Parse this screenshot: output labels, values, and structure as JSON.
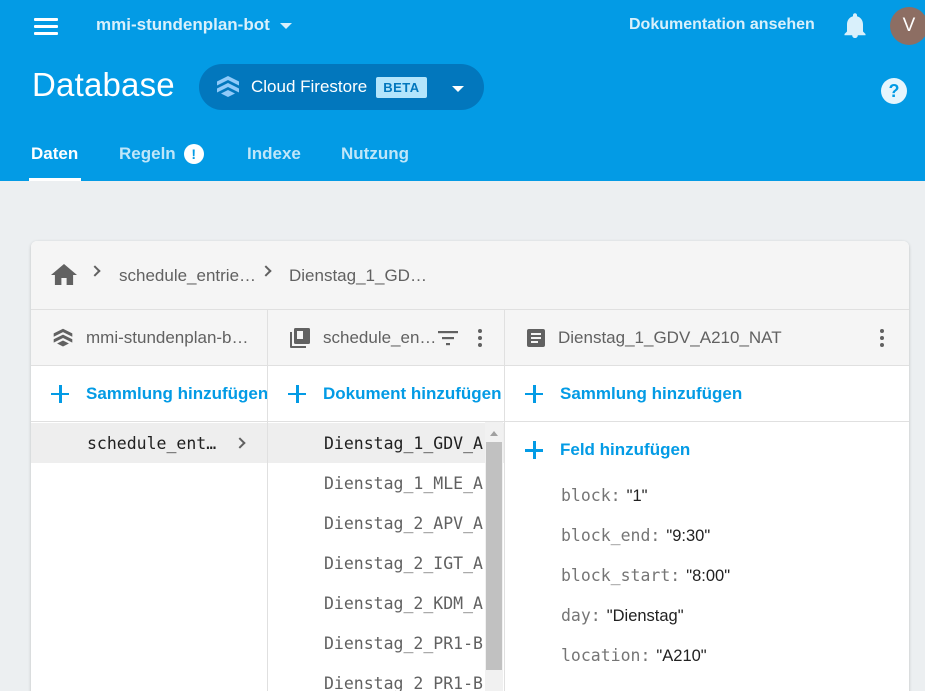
{
  "header": {
    "project_name": "mmi-stundenplan-bot",
    "docs_link": "Dokumentation ansehen",
    "avatar_initial": "V",
    "page_title": "Database",
    "db_name": "Cloud Firestore",
    "beta_badge": "BETA",
    "help_glyph": "?"
  },
  "tabs": [
    {
      "label": "Daten"
    },
    {
      "label": "Regeln",
      "alert": "!"
    },
    {
      "label": "Indexe"
    },
    {
      "label": "Nutzung"
    }
  ],
  "breadcrumb": [
    "schedule_entrie…",
    "Dienstag_1_GD…"
  ],
  "columns": {
    "root": {
      "title": "mmi-stundenplan-b…",
      "add_label": "Sammlung hinzufügen",
      "items": [
        "schedule_ent…"
      ]
    },
    "collection": {
      "title": "schedule_en…",
      "add_label": "Dokument hinzufügen",
      "items": [
        "Dienstag_1_GDV_A",
        "Dienstag_1_MLE_A",
        "Dienstag_2_APV_A",
        "Dienstag_2_IGT_A",
        "Dienstag_2_KDM_A",
        "Dienstag_2_PR1-B",
        "Dienstag_2_PR1-B"
      ]
    },
    "document": {
      "title": "Dienstag_1_GDV_A210_NAT",
      "add_collection_label": "Sammlung hinzufügen",
      "add_field_label": "Feld hinzufügen",
      "fields": [
        {
          "key": "block:",
          "value": "\"1\""
        },
        {
          "key": "block_end:",
          "value": "\"9:30\""
        },
        {
          "key": "block_start:",
          "value": "\"8:00\""
        },
        {
          "key": "day:",
          "value": "\"Dienstag\""
        },
        {
          "key": "location:",
          "value": "\"A210\""
        }
      ]
    }
  },
  "icons": {
    "menu": "menu-icon",
    "bell": "bell-icon",
    "firestore": "firestore-icon",
    "home": "home-icon",
    "collection": "collection-icon",
    "document": "document-icon",
    "filter": "filter-icon"
  },
  "colors": {
    "header_bg": "#039be5",
    "db_pill": "#0277bd",
    "accent": "#039be5",
    "page_bg": "#eceff1"
  }
}
